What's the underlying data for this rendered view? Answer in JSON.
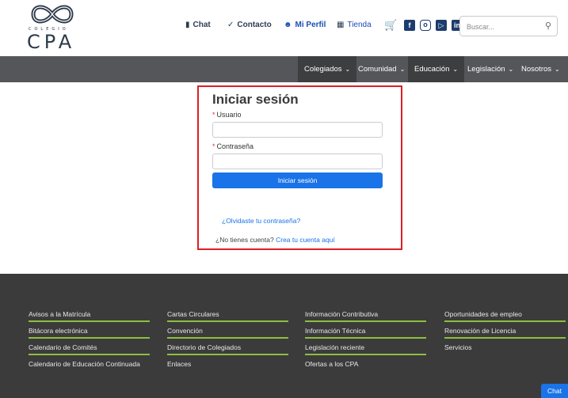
{
  "brand": {
    "small": "COLEGIO",
    "name": "CPA"
  },
  "topnav": {
    "chat": "Chat",
    "contacto": "Contacto",
    "perfil": "Mi Perfil",
    "tienda": "Tienda"
  },
  "search": {
    "placeholder": "Buscar..."
  },
  "mainnav": {
    "items": [
      "Colegiados",
      "Comunidad",
      "Educación",
      "Legislación",
      "Nosotros"
    ]
  },
  "login": {
    "title": "Iniciar sesión",
    "user_label": "Usuario",
    "password_label": "Contraseña",
    "required_mark": "*",
    "submit": "Iniciar sesión",
    "forgot": "¿Olvidaste tu contraseña?",
    "no_account": "¿No tienes cuenta?",
    "create_account": "Crea tu cuenta aquí"
  },
  "footer": {
    "col1": [
      "Avisos a la Matrícula",
      "Bitácora electrónica",
      "Calendario de Comités",
      "Calendario de Educación Continuada"
    ],
    "col2": [
      "Cartas Circulares",
      "Convención",
      "Directorio de Colegiados",
      "Enlaces"
    ],
    "col3": [
      "Información Contributiva",
      "Información Técnica",
      "Legislación reciente",
      "Ofertas a los CPA"
    ],
    "col4": [
      "Oportunidades de empleo",
      "Renovación de Licencia",
      "Servicios"
    ]
  },
  "chat_button": "Chat",
  "colors": {
    "accent": "#1a73e8",
    "highlight_border": "#dd1f25",
    "footer_line": "#8fbe3f",
    "nav_bg": "#555659"
  },
  "icons": [
    "logo-icon",
    "chat-bubble-icon",
    "phone-icon",
    "user-icon",
    "gift-icon",
    "cart-icon",
    "facebook-icon",
    "instagram-icon",
    "youtube-icon",
    "linkedin-icon",
    "search-icon"
  ]
}
